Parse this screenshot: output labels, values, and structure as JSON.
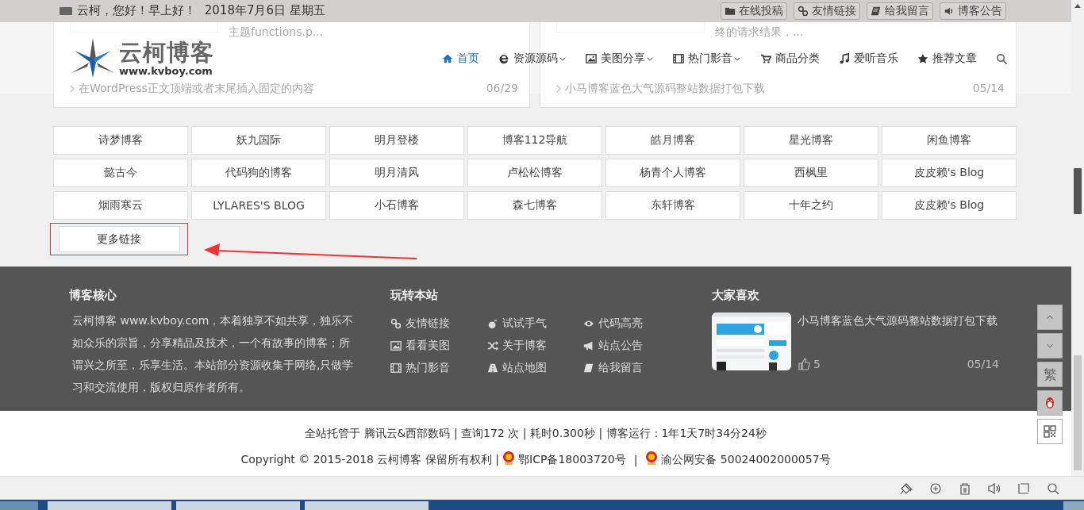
{
  "top_bar": {
    "greeting": "云柯，您好！早上好！",
    "date": "2018年7月6日 星期五",
    "links": [
      {
        "label": "在线投稿"
      },
      {
        "label": "友情链接"
      },
      {
        "label": "给我留言"
      },
      {
        "label": "博客公告"
      }
    ]
  },
  "background_cards": [
    {
      "excerpt": "主题functions.p...",
      "item": "在WordPress正文顶端或者末尾插入固定的内容",
      "date": "06/29"
    },
    {
      "excerpt": "终的请求结果，...",
      "item": "小马博客蓝色大气源码整站数据打包下载",
      "date": "05/14"
    }
  ],
  "logo": {
    "name": "云柯博客",
    "url": "www.kvboy.com"
  },
  "nav": [
    {
      "label": "首页",
      "selected": true,
      "dropdown": false
    },
    {
      "label": "资源源码",
      "selected": false,
      "dropdown": true
    },
    {
      "label": "美图分享",
      "selected": false,
      "dropdown": true
    },
    {
      "label": "热门影音",
      "selected": false,
      "dropdown": true
    },
    {
      "label": "商品分类",
      "selected": false,
      "dropdown": false
    },
    {
      "label": "爱听音乐",
      "selected": false,
      "dropdown": false
    },
    {
      "label": "推荐文章",
      "selected": false,
      "dropdown": false
    }
  ],
  "friend_links": [
    "诗梦博客",
    "妖九国际",
    "明月登楼",
    "博客112导航",
    "皓月博客",
    "星光博客",
    "闲鱼博客",
    "懿古今",
    "代码狗的博客",
    "明月清风",
    "卢松松博客",
    "杨青个人博客",
    "西枫里",
    "皮皮赖's Blog",
    "烟雨寒云",
    "LYLARES'S BLOG",
    "小石博客",
    "森七博客",
    "东轩博客",
    "十年之约",
    "皮皮赖's Blog"
  ],
  "more_button": "更多链接",
  "footer": {
    "about": {
      "title": "博客核心",
      "text": "云柯博客 www.kvboy.com，本着独享不如共享，独乐不如众乐的宗旨，分享精品及技术，一个有故事的博客；所谓兴之所至，乐享生活。本站部分资源收集于网络,只做学习和交流使用，版权归原作者所有。"
    },
    "site": {
      "title": "玩转本站",
      "links": [
        "友情链接",
        "试试手气",
        "代码高亮",
        "看看美图",
        "关于博客",
        "站点公告",
        "热门影音",
        "站点地图",
        "给我留言"
      ]
    },
    "popular": {
      "title": "大家喜欢",
      "post": {
        "title": "小马博客蓝色大气源码整站数据打包下载",
        "likes": "5",
        "date": "05/14"
      }
    }
  },
  "float_tools": {
    "traditional": "繁"
  },
  "bottom": {
    "stats": "全站托管于 腾讯云&西部数码 | 查询172 次 | 耗时0.300秒 | 博客运行：1年1天7时34分24秒",
    "copyright": "Copyright © 2015-2018  云柯博客  保留所有权利 |",
    "icp": "鄂ICP备18003720号",
    "separator": "|",
    "police": "渝公网安备 50024002000057号"
  }
}
